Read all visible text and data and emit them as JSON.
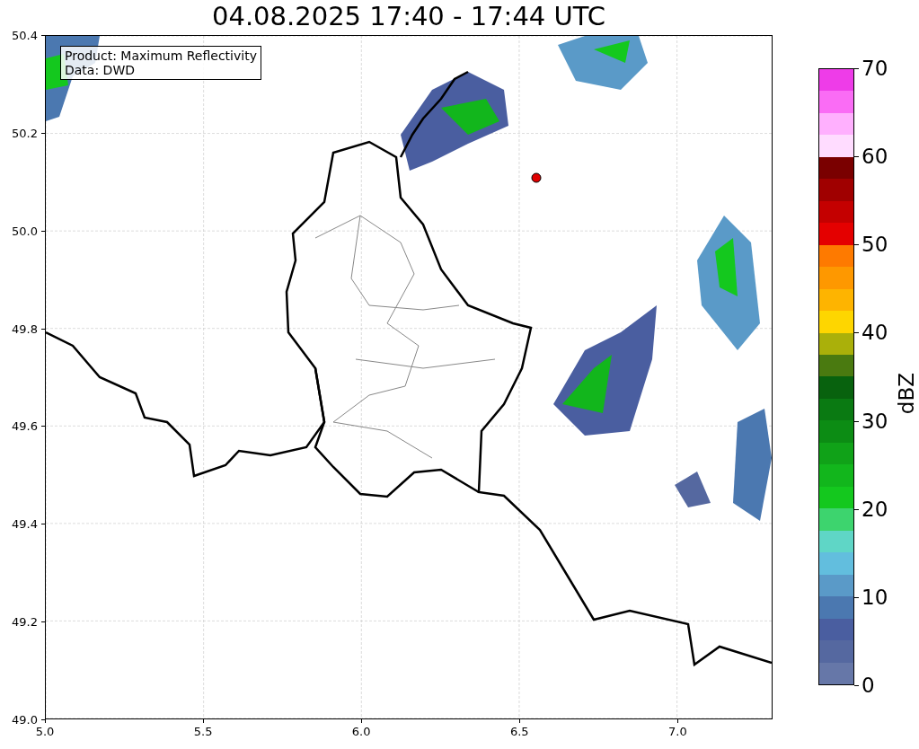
{
  "title": "04.08.2025 17:40 - 17:44 UTC",
  "legend": {
    "lines": [
      "Product: Maximum Reflectivity",
      "Data: DWD"
    ]
  },
  "y_axis": {
    "ticks": [
      "50.4",
      "50.2",
      "50.0",
      "49.8",
      "49.6",
      "49.4",
      "49.2",
      "49.0"
    ]
  },
  "x_axis": {
    "ticks": [
      "5.0",
      "5.5",
      "6.0",
      "6.5",
      "7.0"
    ]
  },
  "colorbar": {
    "label": "dBZ",
    "ticks": [
      "70",
      "60",
      "50",
      "40",
      "30",
      "20",
      "10",
      "0"
    ],
    "colors": [
      {
        "color": "#6677a8"
      },
      {
        "color": "#5568a0"
      },
      {
        "color": "#4a5ea0"
      },
      {
        "color": "#4b78b0"
      },
      {
        "color": "#5a9ac8"
      },
      {
        "color": "#62bede"
      },
      {
        "color": "#5fd6c6"
      },
      {
        "color": "#3dd46e"
      },
      {
        "color": "#14c81e"
      },
      {
        "color": "#12b61c"
      },
      {
        "color": "#10a218"
      },
      {
        "color": "#0c8c14"
      },
      {
        "color": "#0a7a12"
      },
      {
        "color": "#08620e"
      },
      {
        "color": "#4a7a10"
      },
      {
        "color": "#aab00a"
      },
      {
        "color": "#fed600"
      },
      {
        "color": "#feb400"
      },
      {
        "color": "#fe9800"
      },
      {
        "color": "#fe7a00"
      },
      {
        "color": "#e40000"
      },
      {
        "color": "#c40000"
      },
      {
        "color": "#a00000"
      },
      {
        "color": "#7a0000"
      },
      {
        "color": "#ffdcff"
      },
      {
        "color": "#ffb0fe"
      },
      {
        "color": "#fa6cf5"
      },
      {
        "color": "#ee3ce8"
      }
    ]
  }
}
